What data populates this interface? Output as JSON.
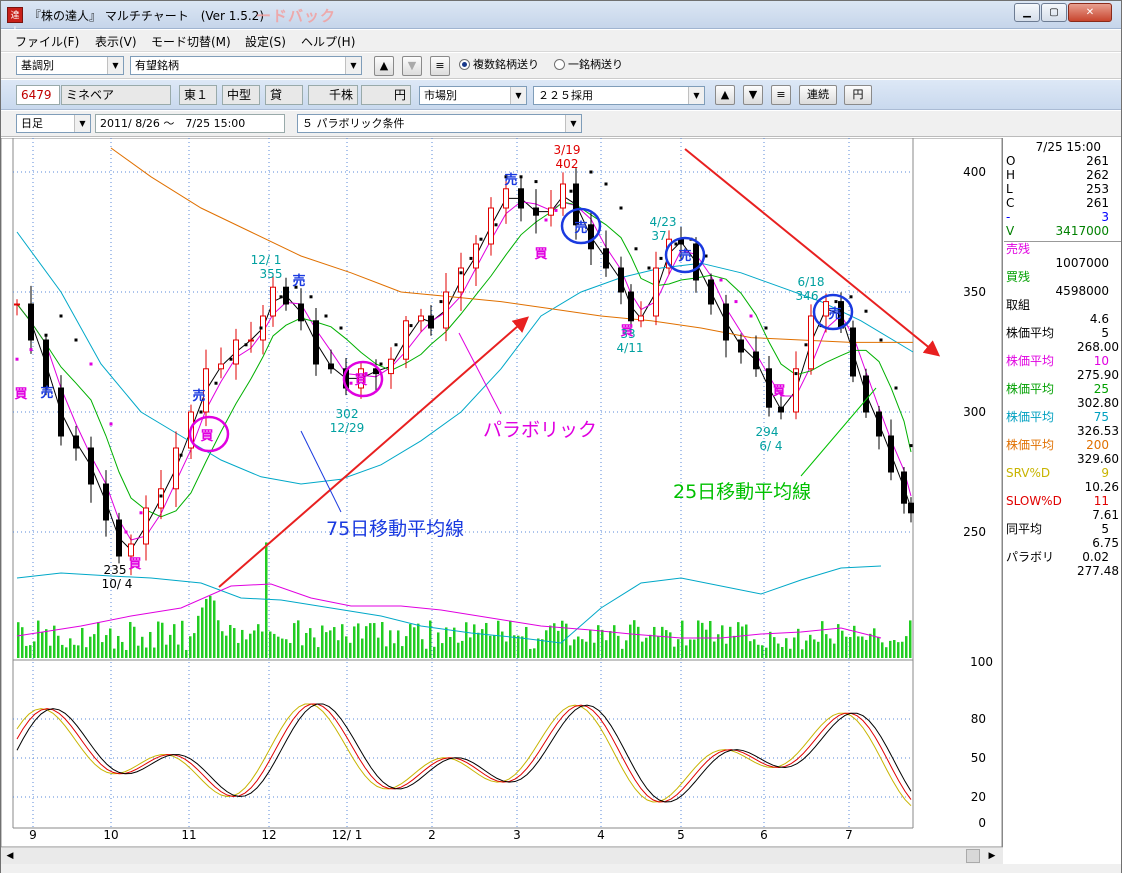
{
  "window": {
    "title": "『株の達人』 マルチチャート　(Ver 1.5.2)",
    "title_ghost": "ードバック",
    "app_icon": "達人"
  },
  "menu": [
    "ファイル(F)",
    "表示(V)",
    "モード切替(M)",
    "設定(S)",
    "ヘルプ(H)"
  ],
  "toolbar1": {
    "category_select": "基調別",
    "list_select": "有望銘柄",
    "list_button": "≡",
    "radio_multi": "複数銘柄送り",
    "radio_single": "一銘柄送り"
  },
  "toolbar2": {
    "code": "6479",
    "name": "ミネベア",
    "market": "東１",
    "size": "中型",
    "lending": "貸",
    "unit": "千株",
    "currency": "円",
    "market_select": "市場別",
    "index_select": "２２５採用",
    "list_button": "≡",
    "continuous_button": "連続",
    "yen_button": "円"
  },
  "toolbar3": {
    "period_select": "日足",
    "date_range": "2011/ 8/26 〜　7/25 15:00",
    "condition_select": "５ パラボリック条件"
  },
  "side": {
    "datetime": "7/25 15:00",
    "ohlc": [
      {
        "label": "O",
        "value": "261",
        "color": "#000000"
      },
      {
        "label": "H",
        "value": "262",
        "color": "#000000"
      },
      {
        "label": "L",
        "value": "253",
        "color": "#000000"
      },
      {
        "label": "C",
        "value": "261",
        "color": "#000000"
      },
      {
        "label": "-",
        "value": "3",
        "color": "#0000ff"
      },
      {
        "label": "V",
        "value": "3417000",
        "color": "#008000"
      }
    ],
    "ask_label": "売残",
    "ask_value": "1007000",
    "bid_label": "買残",
    "bid_value": "4598000",
    "ratio_label": "取組",
    "ratio_value": "4.6",
    "indicators": [
      {
        "label": "株価平均",
        "param": "5",
        "value": "268.00",
        "color": "#000000"
      },
      {
        "label": "株価平均",
        "param": "10",
        "value": "275.90",
        "color": "#e000e0"
      },
      {
        "label": "株価平均",
        "param": "25",
        "value": "302.80",
        "color": "#00a000"
      },
      {
        "label": "株価平均",
        "param": "75",
        "value": "326.53",
        "color": "#00a0c0"
      },
      {
        "label": "株価平均",
        "param": "200",
        "value": "329.60",
        "color": "#e07000"
      },
      {
        "label": "SRV%D",
        "param": "9",
        "value": "10.26",
        "color": "#c8b400"
      },
      {
        "label": "SLOW%D",
        "param": "11",
        "value": "7.61",
        "color": "#e00000"
      },
      {
        "label": "同平均",
        "param": "5",
        "value": "6.75",
        "color": "#000000"
      },
      {
        "label": "パラボリ",
        "param": "0.02",
        "value": "277.48",
        "color": "#000000"
      }
    ]
  },
  "chart": {
    "price_axis": [
      "400",
      "350",
      "300",
      "250"
    ],
    "vol_axis": "100",
    "osc_axis": [
      "80",
      "50",
      "20",
      "0"
    ],
    "months": [
      "9",
      "10",
      "11",
      "12",
      "12/ 1",
      "2",
      "3",
      "4",
      "5",
      "6",
      "7"
    ],
    "labels": {
      "h1_date": "12/ 1",
      "h1_val": "355",
      "l1_val": "302",
      "l1_date": "12/29",
      "h2_date": "3/19",
      "h2_val": "402",
      "h3_date": "4/23",
      "h3_val": "37",
      "l2_val": "33",
      "l2_date": "4/11",
      "h4_date": "6/18",
      "h4_val": "346",
      "l3_val": "294",
      "l3_date": "6/ 4",
      "l0_val": "235",
      "l0_date": "10/ 4"
    },
    "annot_parabolic": "パラボリック",
    "annot_ma75": "75日移動平均線",
    "annot_ma25": "25日移動平均線",
    "buy": "買",
    "sell": "売"
  }
}
